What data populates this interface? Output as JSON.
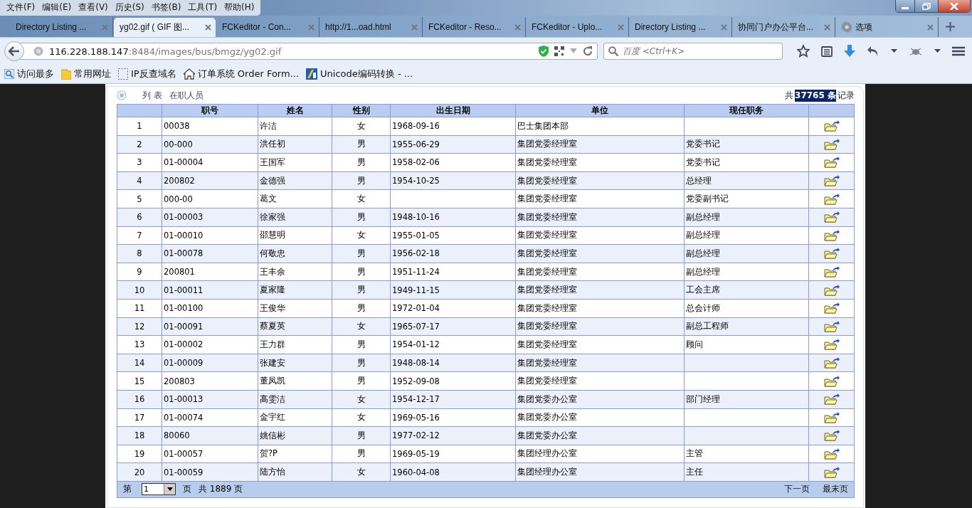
{
  "menu": [
    "文件(F)",
    "编辑(E)",
    "查看(V)",
    "历史(S)",
    "书签(B)",
    "工具(T)",
    "帮助(H)"
  ],
  "tabs": [
    {
      "label": "Directory Listing ...",
      "selected": false,
      "kind": "page"
    },
    {
      "label": "yg02.gif ( GIF 图...",
      "selected": true,
      "kind": "page"
    },
    {
      "label": "FCKeditor - Con...",
      "selected": false,
      "kind": "page"
    },
    {
      "label": "http://1...oad.html",
      "selected": false,
      "kind": "page"
    },
    {
      "label": "FCKeditor - Reso...",
      "selected": false,
      "kind": "page"
    },
    {
      "label": "FCKeditor - Uplo...",
      "selected": false,
      "kind": "page"
    },
    {
      "label": "Directory Listing ...",
      "selected": false,
      "kind": "page"
    },
    {
      "label": "协同门户办公平台...",
      "selected": false,
      "kind": "page"
    },
    {
      "label": "选项",
      "selected": false,
      "kind": "settings"
    }
  ],
  "address": {
    "host": "116.228.188.147",
    "path": ":8484/images/bus/bmgz/yg02.gif"
  },
  "search": {
    "placeholder": "百度 <Ctrl+K>"
  },
  "bookmarks": [
    {
      "label": "访问最多",
      "kind": "search"
    },
    {
      "label": "常用网址",
      "kind": "folder"
    },
    {
      "label": "IP反查域名",
      "kind": "blank"
    },
    {
      "label": "订单系统 Order Form...",
      "kind": "home"
    },
    {
      "label": "Unicode编码转换 - ...",
      "kind": "unicode"
    }
  ],
  "panel": {
    "title": "列 表",
    "subtitle": "在职人员",
    "count_prefix": "共",
    "count": "37765 条",
    "count_highlighted": true,
    "count_suffix": "记录"
  },
  "table": {
    "columns": [
      "",
      "职号",
      "姓名",
      "性别",
      "出生日期",
      "单位",
      "现任职务",
      ""
    ],
    "rows": [
      [
        "1",
        "00038",
        "许洁",
        "女",
        "1968-09-16",
        "巴士集团本部",
        ""
      ],
      [
        "2",
        "00-000",
        "洪任初",
        "男",
        "1955-06-29",
        "集团党委经理室",
        "党委书记"
      ],
      [
        "3",
        "01-00004",
        "王国军",
        "男",
        "1958-02-06",
        "集团党委经理室",
        "党委书记"
      ],
      [
        "4",
        "200802",
        "金德强",
        "男",
        "1954-10-25",
        "集团党委经理室",
        "总经理"
      ],
      [
        "5",
        "000-00",
        "葛文",
        "女",
        "",
        "集团党委经理室",
        "党委副书记"
      ],
      [
        "6",
        "01-00003",
        "徐家强",
        "男",
        "1948-10-16",
        "集团党委经理室",
        "副总经理"
      ],
      [
        "7",
        "01-00010",
        "邵慧明",
        "女",
        "1955-01-05",
        "集团党委经理室",
        "副总经理"
      ],
      [
        "8",
        "01-00078",
        "何敬忠",
        "男",
        "1956-02-18",
        "集团党委经理室",
        "副总经理"
      ],
      [
        "9",
        "200801",
        "王丰余",
        "男",
        "1951-11-24",
        "集团党委经理室",
        "副总经理"
      ],
      [
        "10",
        "01-00011",
        "夏家隆",
        "男",
        "1949-11-15",
        "集团党委经理室",
        "工会主席"
      ],
      [
        "11",
        "01-00100",
        "王俊华",
        "男",
        "1972-01-04",
        "集团党委经理室",
        "总会计师"
      ],
      [
        "12",
        "01-00091",
        "蔡夏英",
        "女",
        "1965-07-17",
        "集团党委经理室",
        "副总工程师"
      ],
      [
        "13",
        "01-00002",
        "王力群",
        "男",
        "1954-01-12",
        "集团党委经理室",
        "顾问"
      ],
      [
        "14",
        "01-00009",
        "张建安",
        "男",
        "1948-08-14",
        "集团党委经理室",
        ""
      ],
      [
        "15",
        "200803",
        "董凤凯",
        "男",
        "1952-09-08",
        "集团党委经理室",
        ""
      ],
      [
        "16",
        "01-00013",
        "高雯洁",
        "女",
        "1954-12-17",
        "集团党委办公室",
        "部门经理"
      ],
      [
        "17",
        "01-00074",
        "金宇红",
        "女",
        "1969-05-16",
        "集团党委办公室",
        ""
      ],
      [
        "18",
        "80060",
        "姚信彬",
        "男",
        "1977-02-12",
        "集团党委办公室",
        ""
      ],
      [
        "19",
        "01-00057",
        "贺?P",
        "男",
        "1969-05-19",
        "集团经理办公室",
        "主管"
      ],
      [
        "20",
        "01-00059",
        "陆方怡",
        "女",
        "1960-04-08",
        "集团经理办公室",
        "主任"
      ]
    ]
  },
  "pager": {
    "prefix": "第",
    "page": "1",
    "mid": "页",
    "total": "共 1889 页",
    "next": "下一页",
    "last": "最末页"
  }
}
